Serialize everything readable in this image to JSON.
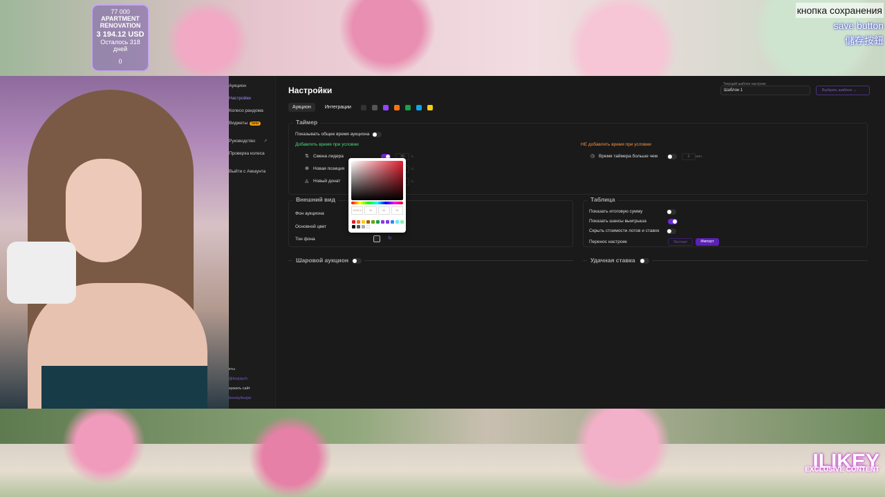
{
  "overlay": {
    "goal_count": "77 000",
    "goal_title": "APARTMENT RENOVATION",
    "amount": "3 194.12 USD",
    "remaining": "Осталось 318 дней",
    "counter": "0"
  },
  "captions": {
    "ru": "кнопка сохранения",
    "en": "save button",
    "zh": "儲存按鈕"
  },
  "sidebar": {
    "items": [
      {
        "label": "Аукцион"
      },
      {
        "label": "Настройки"
      },
      {
        "label": "Колесо рандома"
      },
      {
        "label": "Виджеты",
        "badge": "beta"
      },
      {
        "label": "Руководство"
      },
      {
        "label": "Проверка колеса"
      },
      {
        "label": "Выйти с Аккаунта"
      }
    ],
    "bottom": {
      "contacts": "кты",
      "contact_link": "@kozjaych",
      "support": "ержать сайт",
      "support_link": "boosty/kozjal"
    }
  },
  "header": {
    "title": "Настройки",
    "template_label": "Текущий шаблон настроек",
    "template_value": "Шаблон 1",
    "choose_template": "Выбрать шаблон"
  },
  "tabs": [
    {
      "label": "Аукцион",
      "active": true
    },
    {
      "label": "Интеграции",
      "active": false
    }
  ],
  "timer": {
    "title": "Таймер",
    "show_total_time": "Показывать общее время аукциона",
    "add_time_heading": "Добавлять время при условии",
    "leader_change": "Смена лидера",
    "new_position": "Новая позиция",
    "new_donation": "Новый донат",
    "leader_change_value": "30",
    "unit_seconds": "с.",
    "no_add_time_heading": "НЕ добавлять время при условии",
    "timer_more_than": "Время таймера больше чем",
    "timer_more_value": "2",
    "unit_minutes": "мин."
  },
  "appearance": {
    "title": "Внешний вид",
    "auction_bg": "Фон аукциона",
    "main_color": "Основной цвет",
    "bg_tone": "Тон фона"
  },
  "table": {
    "title": "Таблица",
    "show_total": "Показать итоговую сумму",
    "show_win_chance": "Показать шансы выигрыша",
    "hide_lot_costs": "Скрыть стоимости лотов и ставок",
    "transfer_settings": "Перенос настроек",
    "export": "Экспорт",
    "import": "Импорт"
  },
  "ball_auction": "Шаровой аукцион",
  "lucky_bet": "Удачная ставка",
  "color_picker": {
    "hex": "2424CA",
    "r": "36",
    "g": "36",
    "b": "36",
    "swatches": [
      "#e11d2f",
      "#f97316",
      "#facc15",
      "#a16207",
      "#65a30d",
      "#16a34a",
      "#9333ea",
      "#7c3aed",
      "#3b82f6",
      "#67e8f9",
      "#86efac",
      "#111111",
      "#555555",
      "#aaaaaa",
      "#ffffff"
    ]
  },
  "watermark": {
    "main": "ILIKEY",
    "sub": "EXCLUSIVE CONTENT"
  },
  "colors": {
    "accent": "#6d28d9",
    "bg": "#1a1a1a",
    "green_heading": "#4ade80",
    "orange_heading": "#fb923c"
  }
}
